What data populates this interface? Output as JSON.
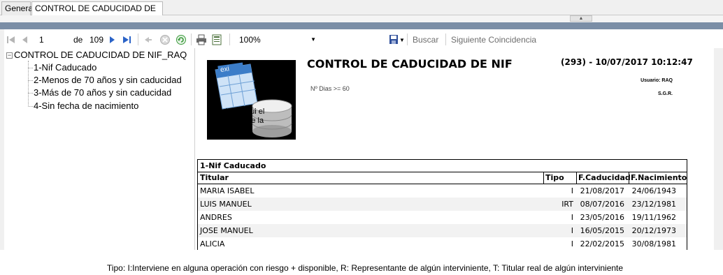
{
  "tabs": [
    {
      "label": "General"
    },
    {
      "label": "CONTROL DE CADUCIDAD DE NIF"
    }
  ],
  "toolbar": {
    "page_current": "1",
    "page_of_label": "de",
    "page_total": "109",
    "zoom_value": "100%",
    "search_label": "Buscar",
    "next_match_label": "Siguiente Coincidencia"
  },
  "tree": {
    "root_label": "CONTROL DE CADUCIDAD DE NIF_RAQ",
    "items": [
      {
        "label": "1-Nif Caducado"
      },
      {
        "label": "2-Menos de 70 años y sin caducidad"
      },
      {
        "label": "3-Más de 70 años y sin caducidad"
      },
      {
        "label": "4-Sin fecha de nacimiento"
      }
    ]
  },
  "report": {
    "logo_text": "Incluya aqui el Logotipo de la SGR",
    "logo_badge": "exi",
    "title": "CONTROL DE CADUCIDAD DE NIF",
    "stamp": "(293) - 10/07/2017 10:12:47",
    "filter": "Nº Dias >= 60",
    "user": "Usuario: RAQ",
    "org": "S.G.R.",
    "section_title": "1-Nif Caducado",
    "columns": {
      "titular": "Titular",
      "tipo": "Tipo",
      "fcaducidad": "F.Caducidad",
      "fnacimiento": "F.Nacimiento"
    },
    "rows": [
      {
        "titular": "MARIA ISABEL",
        "tipo": "I",
        "fcaducidad": "21/08/2017",
        "fnacimiento": "24/06/1943"
      },
      {
        "titular": "LUIS MANUEL",
        "tipo": "IRT",
        "fcaducidad": "08/07/2016",
        "fnacimiento": "23/12/1981"
      },
      {
        "titular": "ANDRES",
        "tipo": "I",
        "fcaducidad": "23/05/2016",
        "fnacimiento": "19/11/1962"
      },
      {
        "titular": "JOSE MANUEL",
        "tipo": "I",
        "fcaducidad": "16/05/2015",
        "fnacimiento": "20/12/1973"
      },
      {
        "titular": "ALICIA",
        "tipo": "I",
        "fcaducidad": "22/02/2015",
        "fnacimiento": "30/08/1981"
      }
    ]
  },
  "footer_text": "Tipo: I:Interviene en alguna operación con riesgo + disponible, R: Representante de algún interviniente, T: Titular real de algún interviniente",
  "colors": {
    "accent_bar": "#7b8ea6",
    "nav_icon": "#2b63c7",
    "refresh_icon": "#3a9a3a"
  }
}
